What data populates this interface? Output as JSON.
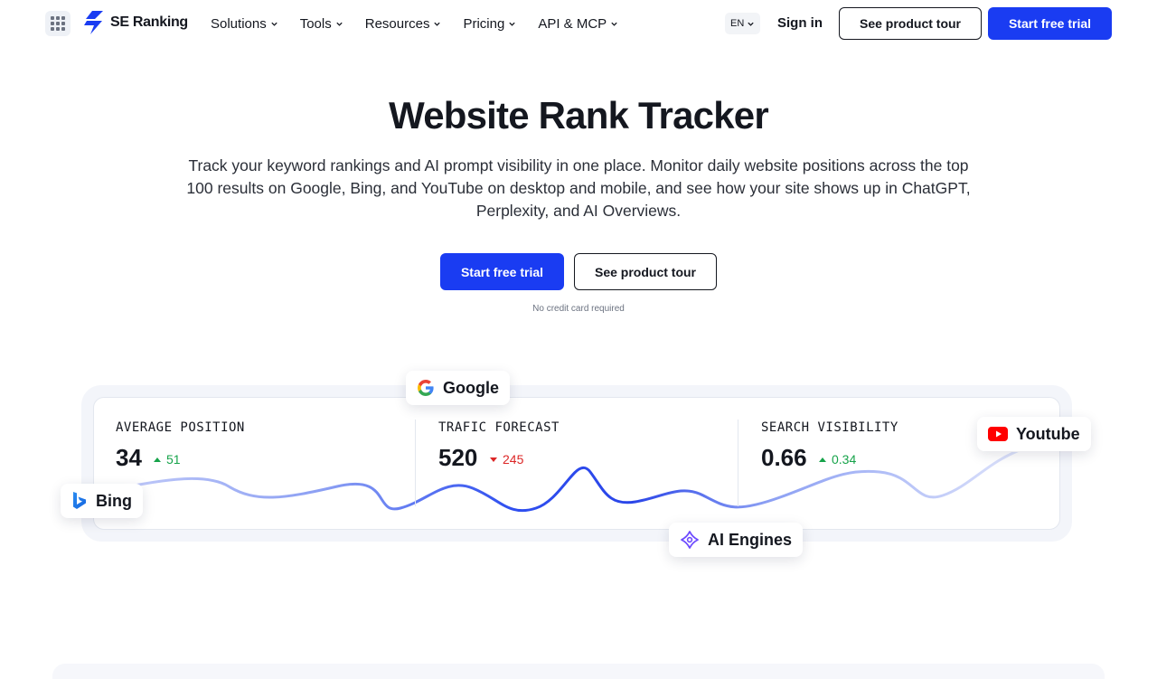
{
  "header": {
    "logo_text": "SE Ranking",
    "nav": [
      {
        "label": "Solutions"
      },
      {
        "label": "Tools"
      },
      {
        "label": "Resources"
      },
      {
        "label": "Pricing"
      },
      {
        "label": "API & MCP"
      }
    ],
    "language": "EN",
    "sign_in": "Sign in",
    "product_tour": "See product tour",
    "free_trial": "Start free trial"
  },
  "hero": {
    "title": "Website Rank Tracker",
    "subtitle": "Track your keyword rankings and AI prompt visibility in one place. Monitor daily website positions across the top 100 results on Google, Bing, and YouTube on desktop and mobile, and see how your site shows up in ChatGPT, Perplexity, and AI Overviews.",
    "primary_cta": "Start free trial",
    "secondary_cta": "See product tour",
    "note": "No credit card required"
  },
  "dashboard": {
    "metrics": [
      {
        "label": "AVERAGE POSITION",
        "value": "34",
        "delta": "51",
        "direction": "up"
      },
      {
        "label": "TRAFIC FORECAST",
        "value": "520",
        "delta": "245",
        "direction": "down"
      },
      {
        "label": "SEARCH VISIBILITY",
        "value": "0.66",
        "delta": "0.34",
        "direction": "up"
      }
    ],
    "engines": [
      "Google",
      "Bing",
      "Youtube",
      "AI Engines"
    ]
  },
  "colors": {
    "primary": "#1a3cf2",
    "text": "#14171f",
    "positive": "#16a34a",
    "negative": "#dc2626",
    "youtube": "#ff0000",
    "ai_engines": "#6d4aff"
  },
  "icons": {
    "apps": "grid-icon",
    "logo": "se-ranking-logo-icon",
    "google": "google-icon",
    "bing": "bing-icon",
    "youtube": "youtube-icon",
    "ai_engines": "ai-engines-icon",
    "dropdown": "chevron-down-icon"
  }
}
